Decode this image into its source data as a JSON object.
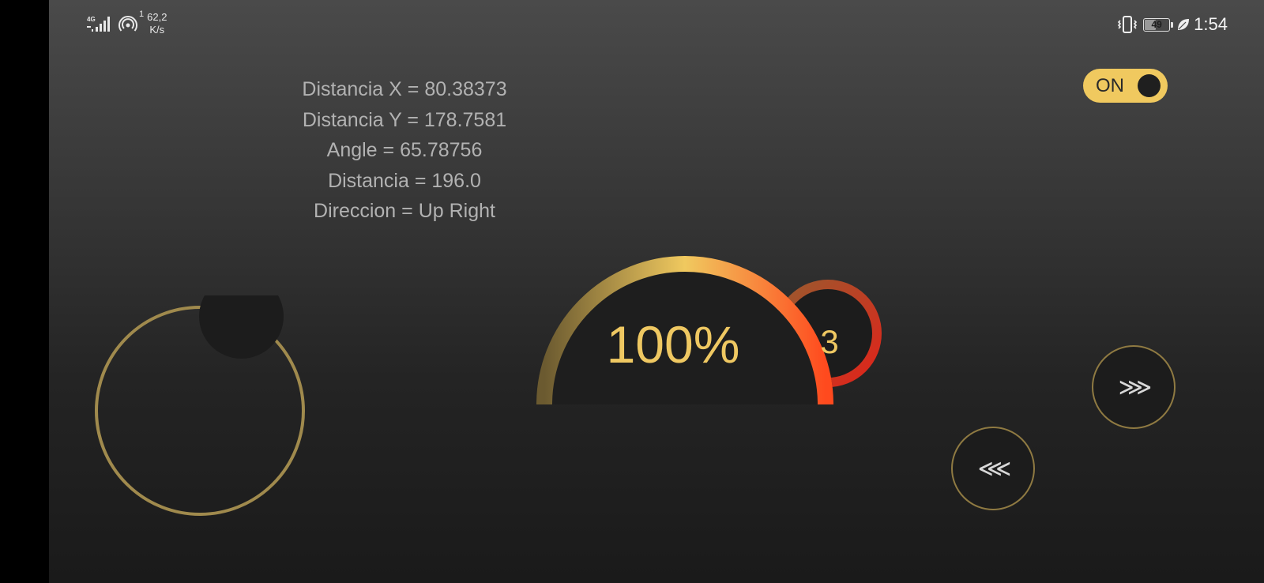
{
  "status_bar": {
    "network_label": "4G",
    "hotspot_count": "1",
    "speed_value": "62,2",
    "speed_unit": "K/s",
    "battery_level": "49",
    "battery_fraction": 0.49,
    "time": "1:54",
    "icons": [
      "signal-4g-icon",
      "hotspot-icon",
      "vibrate-icon",
      "battery-icon",
      "leaf-icon"
    ]
  },
  "readout": {
    "distancia_x": "Distancia X = 80.38373",
    "distancia_y": "Distancia Y = 178.7581",
    "angle": "Angle = 65.78756",
    "distancia": "Distancia = 196.0",
    "direccion": "Direccion = Up Right"
  },
  "toggle": {
    "label": "ON",
    "state": true,
    "color": "#f0c95f"
  },
  "gauge": {
    "percent_label": "100%",
    "percent_value": 100,
    "gear_label": "3",
    "gradient_colors": [
      "#6b5a30",
      "#f0c95f",
      "#ff4a1e"
    ]
  },
  "buttons": {
    "forward_label": "⋙",
    "back_label": "⋘"
  },
  "joystick": {
    "ring_color": "#a08a4d"
  }
}
